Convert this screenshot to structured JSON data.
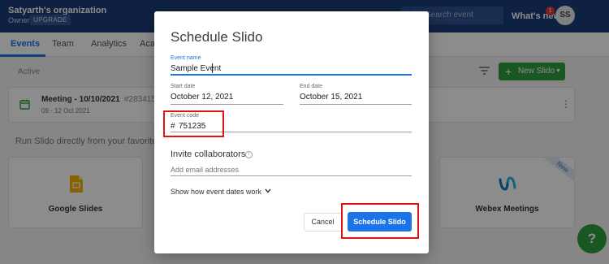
{
  "header": {
    "org_name": "Satyarth's organization",
    "role": "Owner",
    "upgrade_label": "UPGRADE",
    "search_placeholder": "Search event",
    "whats_new": "What's new",
    "notification_count": "1",
    "avatar_initials": "SS"
  },
  "tabs": [
    {
      "label": "Events",
      "active": true
    },
    {
      "label": "Team"
    },
    {
      "label": "Analytics"
    },
    {
      "label": "Acad"
    }
  ],
  "events": {
    "section_label": "Active",
    "new_button_label": "New Slido",
    "items": [
      {
        "title": "Meeting - 10/10/2021",
        "code": "#283415",
        "dates": "09 - 12 Oct 2021"
      }
    ]
  },
  "integrations": {
    "heading": "Run Slido directly from your favorite to",
    "items": [
      {
        "name": "Google Slides"
      },
      {
        "name": "Webex Meetings",
        "badge": "New"
      }
    ]
  },
  "modal": {
    "title": "Schedule Slido",
    "event_name": {
      "label": "Event name",
      "value": "Sample Event"
    },
    "start_date": {
      "label": "Start date",
      "value": "October 12, 2021"
    },
    "end_date": {
      "label": "End date",
      "value": "October 15, 2021"
    },
    "event_code": {
      "label": "Event code",
      "prefix": "#",
      "value": "751235"
    },
    "invite": {
      "title": "Invite collaborators",
      "placeholder": "Add email addresses"
    },
    "show_dates_link": "Show how event dates work",
    "cancel_label": "Cancel",
    "schedule_label": "Schedule Slido"
  },
  "colors": {
    "header_bg": "#1c3d78",
    "primary_blue": "#1a73e8",
    "green": "#2e9e41",
    "highlight_red": "#e11414"
  }
}
